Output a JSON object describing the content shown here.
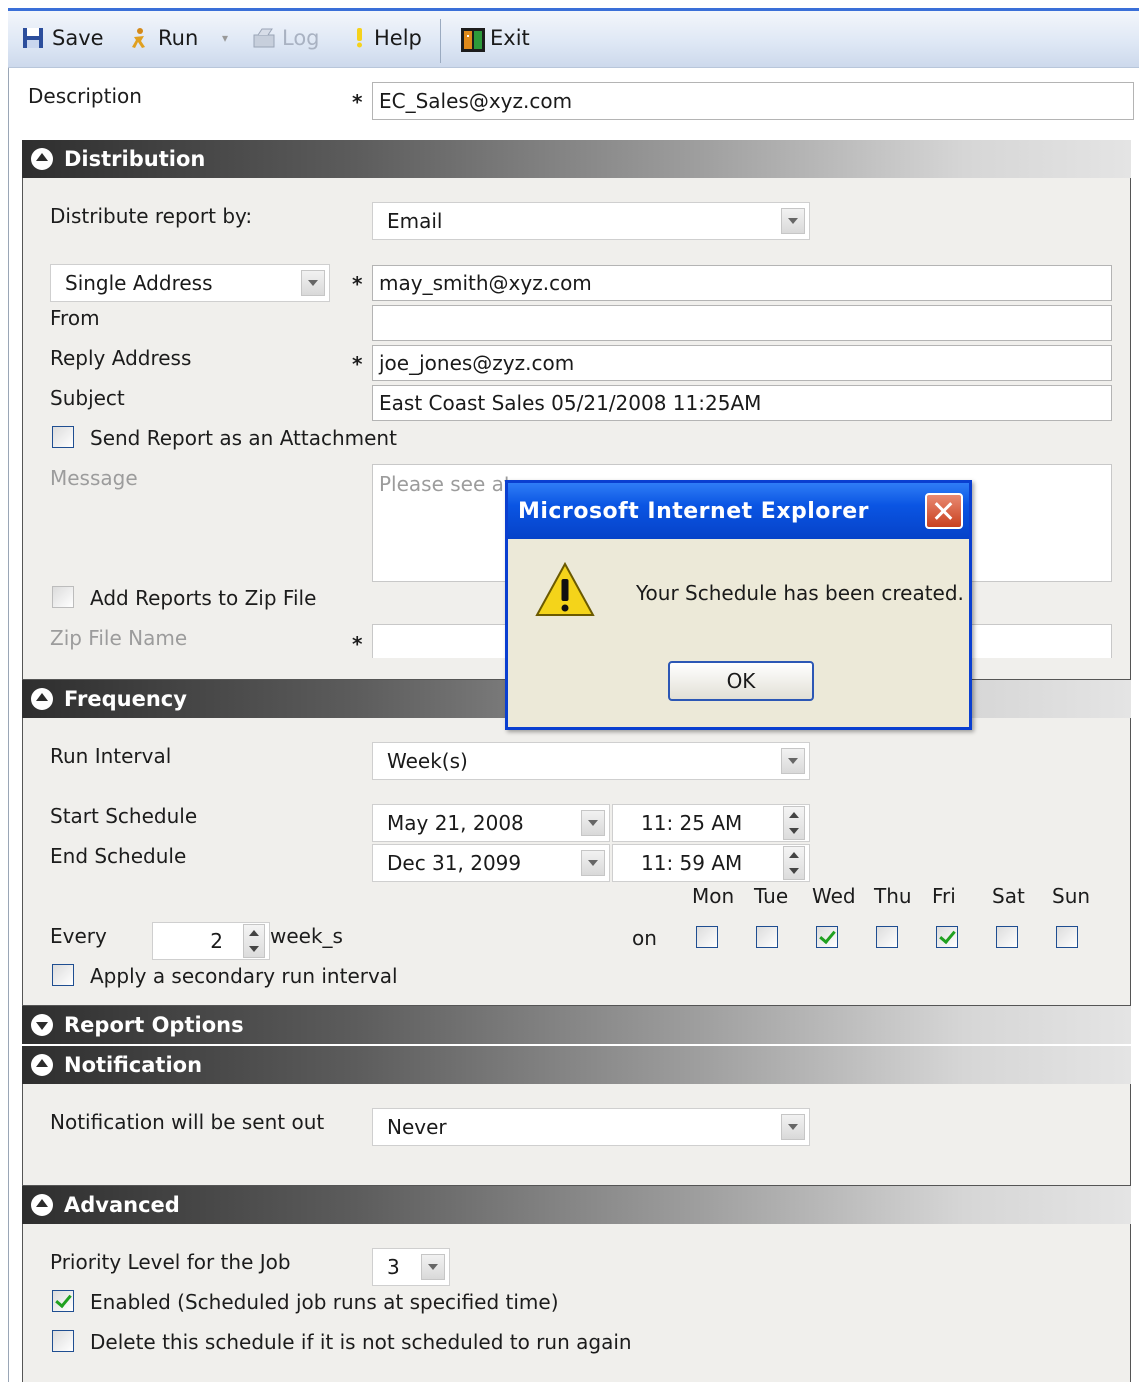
{
  "toolbar": {
    "save": "Save",
    "run": "Run",
    "log": "Log",
    "help": "Help",
    "exit": "Exit"
  },
  "description": {
    "label": "Description",
    "value": "EC_Sales@xyz.com"
  },
  "distribution": {
    "title": "Distribution",
    "distribute_by_label": "Distribute report by:",
    "distribute_by_value": "Email",
    "address_type": "Single Address",
    "address_value": "may_smith@xyz.com",
    "from_label": "From",
    "from_value": "",
    "reply_label": "Reply Address",
    "reply_value": "joe_jones@zyz.com",
    "subject_label": "Subject",
    "subject_value": "East Coast Sales 05/21/2008 11:25AM",
    "attach_label": "Send Report as an Attachment",
    "message_label": "Message",
    "message_value": "Please see at",
    "zip_label": "Add Reports to Zip File",
    "zip_name_label": "Zip File Name"
  },
  "frequency": {
    "title": "Frequency",
    "run_interval_label": "Run Interval",
    "run_interval_value": "Week(s)",
    "start_label": "Start Schedule",
    "start_date": "May 21, 2008",
    "start_time": "11: 25 AM",
    "end_label": "End Schedule",
    "end_date": "Dec 31, 2099",
    "end_time": "11: 59 AM",
    "every_label": "Every",
    "every_value": "2",
    "every_unit": "week_s",
    "on_label": "on",
    "days": [
      {
        "label": "Mon",
        "checked": false
      },
      {
        "label": "Tue",
        "checked": false
      },
      {
        "label": "Wed",
        "checked": true
      },
      {
        "label": "Thu",
        "checked": false
      },
      {
        "label": "Fri",
        "checked": true
      },
      {
        "label": "Sat",
        "checked": false
      },
      {
        "label": "Sun",
        "checked": false
      }
    ],
    "secondary_label": "Apply a secondary run interval"
  },
  "report_options": {
    "title": "Report Options"
  },
  "notification": {
    "title": "Notification",
    "label": "Notification will be sent out",
    "value": "Never"
  },
  "advanced": {
    "title": "Advanced",
    "priority_label": "Priority Level for the Job",
    "priority_value": "3",
    "enabled_label": "Enabled (Scheduled job runs at specified time)",
    "delete_label": "Delete this schedule if it is not scheduled to run again"
  },
  "dialog": {
    "title": "Microsoft Internet Explorer",
    "message": "Your Schedule has been created.",
    "ok": "OK"
  },
  "required_marker": "*",
  "colors": {
    "dialog_title": "#0a55e3",
    "panel_bg": "#f0efec",
    "check_green": "#21a121"
  }
}
